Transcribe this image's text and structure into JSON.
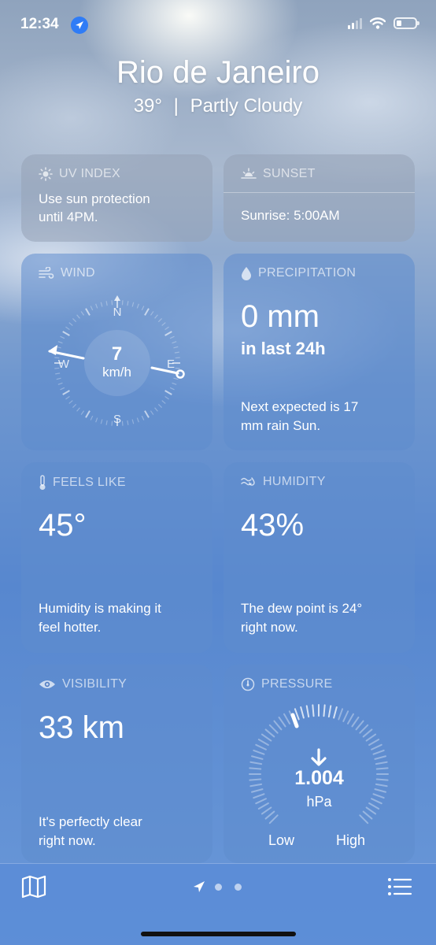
{
  "status_bar": {
    "time": "12:34"
  },
  "header": {
    "city": "Rio de Janeiro",
    "temperature": "39°",
    "separator": "|",
    "condition": "Partly Cloudy"
  },
  "cards": {
    "uv": {
      "title": "UV INDEX",
      "line1": "Use sun protection",
      "line2": "until 4PM."
    },
    "sunset": {
      "title": "SUNSET",
      "sunrise": "Sunrise: 5:00AM"
    },
    "wind": {
      "title": "WIND",
      "speed": "7",
      "unit": "km/h",
      "n": "N",
      "e": "E",
      "s": "S",
      "w": "W"
    },
    "precipitation": {
      "title": "PRECIPITATION",
      "value": "0 mm",
      "period": "in last 24h",
      "note1": "Next expected is 17",
      "note2": "mm rain Sun."
    },
    "feels_like": {
      "title": "FEELS LIKE",
      "value": "45°",
      "note1": "Humidity is making it",
      "note2": "feel hotter."
    },
    "humidity": {
      "title": "HUMIDITY",
      "value": "43%",
      "note1": "The dew point is 24°",
      "note2": "right now."
    },
    "visibility": {
      "title": "VISIBILITY",
      "value": "33 km",
      "note1": "It's perfectly clear",
      "note2": "right now."
    },
    "pressure": {
      "title": "PRESSURE",
      "value": "1.004",
      "unit": "hPa",
      "low": "Low",
      "high": "High"
    }
  },
  "icons": [
    "location-arrow-icon",
    "signal-icon",
    "wifi-icon",
    "battery-icon",
    "sun-icon",
    "sunset-icon",
    "wind-icon",
    "drop-icon",
    "thermometer-icon",
    "humidity-icon",
    "eye-icon",
    "gauge-icon",
    "down-arrow-icon",
    "map-icon",
    "list-icon"
  ]
}
